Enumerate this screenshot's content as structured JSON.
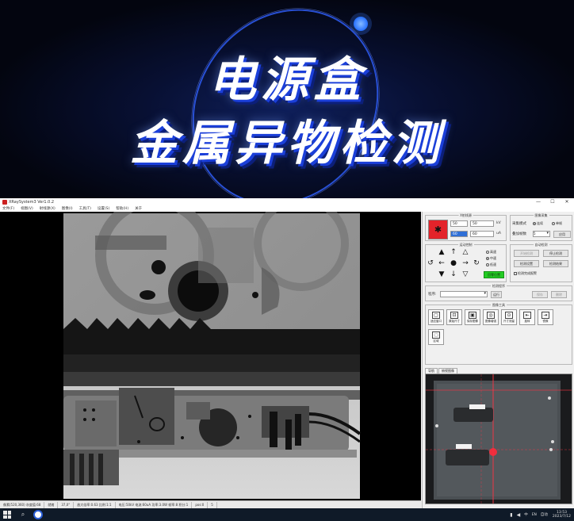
{
  "banner": {
    "line1": "电源盒",
    "line2": "金属异物检测"
  },
  "window": {
    "title": "XRaySystem3 Ver1.0.2",
    "controls": [
      "—",
      "☐",
      "✕"
    ]
  },
  "menu": [
    "文件(F)",
    "视图(V)",
    "射线源(X)",
    "图像(I)",
    "工具(T)",
    "设置(S)",
    "帮助(H)",
    "关于"
  ],
  "status": [
    "像素(520,360)  灰度值:68",
    "就绪",
    "37,0°",
    "放大倍率:0.63 比例:1:1",
    "电压:50kV  电流:60uA  功率:3.0W  帧率:8  积分:1",
    "pos:0",
    "5"
  ],
  "xray": {
    "group_title": "X射线源",
    "voltage_value": "50",
    "voltage_set": "50",
    "voltage_unit": "kV",
    "current_value": "60",
    "current_set": "60",
    "current_unit": "uA",
    "icon": "radiation-icon"
  },
  "detector": {
    "group_title": "图像采集",
    "mode_label": "采集模式",
    "mode_opt1": "连续",
    "mode_opt2": "单帧",
    "frames_label": "叠加帧数",
    "frames_value": "5",
    "apply_btn": "应用"
  },
  "motion": {
    "group_title": "运动控制",
    "speed_opt1": "高速",
    "speed_opt2": "中速",
    "speed_opt3": "低速",
    "home_btn": "回零位置"
  },
  "auto": {
    "group_title": "自动检测",
    "btn1": "开始检测",
    "btn2": "停止检测",
    "btn3": "检测设置",
    "btn4": "检测结果",
    "checkbox": "检测完成报警"
  },
  "program": {
    "group_title": "检测程序",
    "label": "程序:",
    "select_value": "",
    "run_btn": "运行",
    "b1": "保存",
    "b2": "删除"
  },
  "tools": {
    "group_title": "图像工具",
    "items": [
      {
        "icon": "fit-icon",
        "label": "适应窗口"
      },
      {
        "icon": "zoom-icon",
        "label": "原始尺寸"
      },
      {
        "icon": "save-icon",
        "label": "保存图像"
      },
      {
        "icon": "enhance-icon",
        "label": "图像增强"
      },
      {
        "icon": "measure-icon",
        "label": "尺寸测量"
      },
      {
        "icon": "rotate-icon",
        "label": "旋转"
      },
      {
        "icon": "mirror-icon",
        "label": "镜像"
      },
      {
        "icon": "roi-icon",
        "label": "区域"
      }
    ]
  },
  "tabs": [
    "导航",
    "俯视图像"
  ],
  "taskbar": {
    "tray_items": [
      "中",
      "EN",
      "自动"
    ],
    "time": "13:53",
    "date": "2023/7/12"
  },
  "colors": {
    "xray_on": "#e3232a",
    "ready": "#22cc22",
    "accent": "#2b5fd8"
  }
}
